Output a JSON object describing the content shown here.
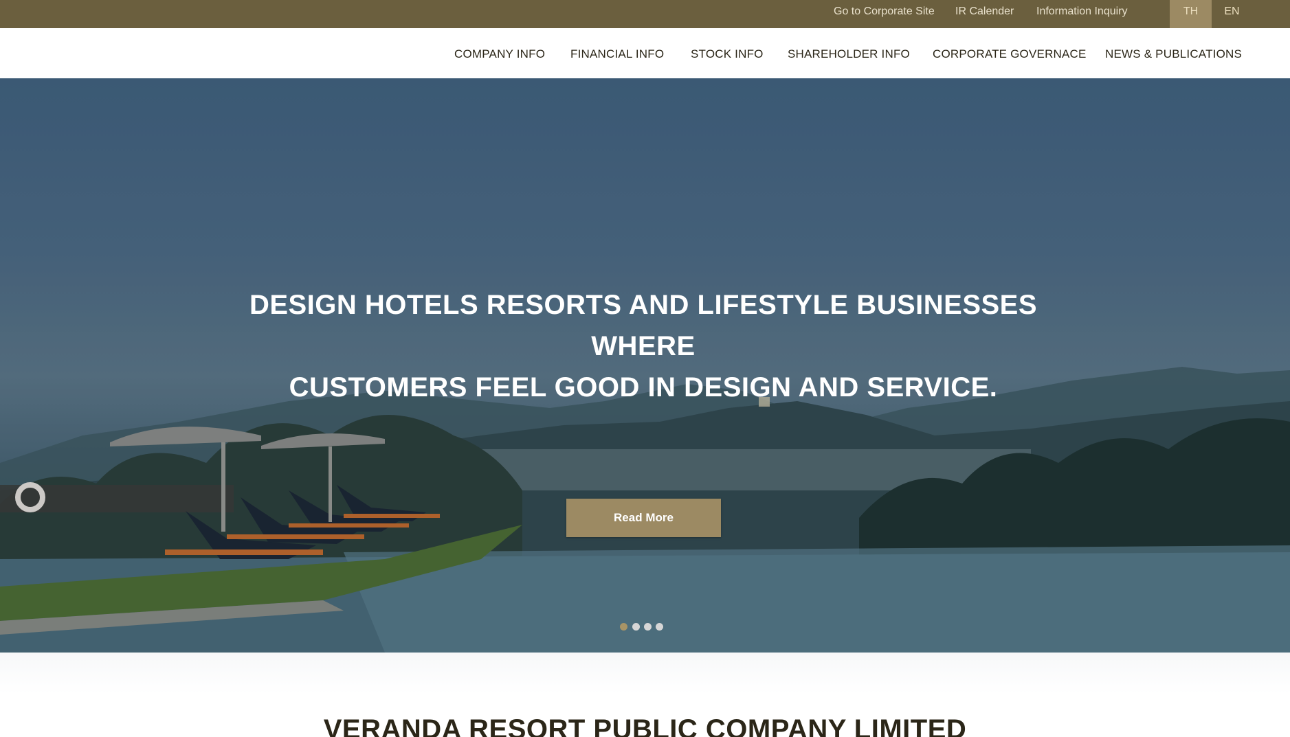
{
  "topbar": {
    "corporate_site": "Go to Corporate Site",
    "ir_calendar": "IR Calender",
    "information_inquiry": "Information Inquiry",
    "lang_th": "TH",
    "lang_en": "EN",
    "active_lang": "TH"
  },
  "nav": {
    "items": [
      {
        "label": "COMPANY INFO"
      },
      {
        "label": "FINANCIAL INFO"
      },
      {
        "label": "STOCK INFO"
      },
      {
        "label": "SHAREHOLDER INFO"
      },
      {
        "label": "CORPORATE GOVERNACE"
      },
      {
        "label": "NEWS & PUBLICATIONS"
      }
    ]
  },
  "hero": {
    "headline_line1": "DESIGN HOTELS RESORTS AND LIFESTYLE BUSINESSES WHERE",
    "headline_line2": "CUSTOMERS FEEL GOOD IN DESIGN AND SERVICE.",
    "cta_label": "Read More",
    "slides_total": 4,
    "active_slide": 1
  },
  "section": {
    "company_title": "VERANDA RESORT PUBLIC COMPANY LIMITED"
  },
  "colors": {
    "topbar_bg": "#6b5f3e",
    "accent_gold": "#9c8a63",
    "nav_text": "#2b2618"
  }
}
